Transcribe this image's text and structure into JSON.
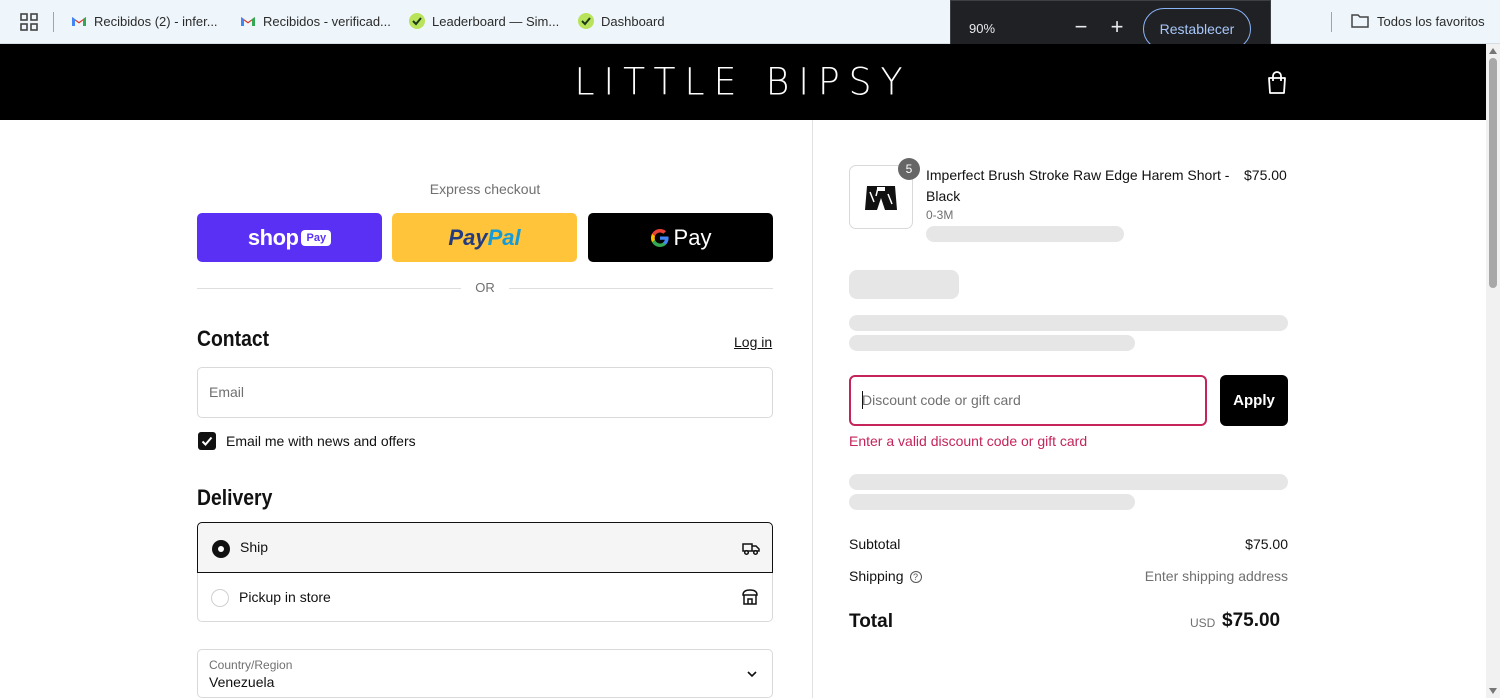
{
  "browser": {
    "bookmarks": [
      {
        "label": "Recibidos (2) - infer...",
        "icon": "gmail-icon"
      },
      {
        "label": "Recibidos - verificad...",
        "icon": "gmail-icon"
      },
      {
        "label": "Leaderboard — Sim...",
        "icon": "site-icon"
      },
      {
        "label": "Dashboard",
        "icon": "site-icon"
      }
    ],
    "all_bookmarks": "Todos los favoritos",
    "zoom": {
      "value": "90%",
      "minus": "−",
      "plus": "+",
      "reset": "Restablecer"
    }
  },
  "shop": {
    "brand": "LITTLE BIPSY"
  },
  "checkout": {
    "express_label": "Express checkout",
    "express": {
      "shop": "shop",
      "shop_pay": "Pay",
      "paypal_a": "Pay",
      "paypal_b": "Pal",
      "gpay": "Pay"
    },
    "or": "OR",
    "contact": {
      "heading": "Contact",
      "login": "Log in",
      "email_placeholder": "Email",
      "newsletter": "Email me with news and offers"
    },
    "delivery": {
      "heading": "Delivery",
      "ship": "Ship",
      "pickup": "Pickup in store"
    },
    "country": {
      "label": "Country/Region",
      "value": "Venezuela"
    }
  },
  "summary": {
    "product": {
      "title": "Imperfect Brush Stroke Raw Edge Harem Short - Black",
      "variant": "0-3M",
      "price": "$75.00",
      "qty": "5"
    },
    "discount": {
      "placeholder": "Discount code or gift card",
      "apply": "Apply",
      "error": "Enter a valid discount code or gift card"
    },
    "subtotal_label": "Subtotal",
    "subtotal": "$75.00",
    "shipping_label": "Shipping",
    "shipping_note": "Enter shipping address",
    "total_label": "Total",
    "currency": "USD",
    "total": "$75.00"
  },
  "colors": {
    "shop_pay": "#5a31f4",
    "paypal": "#ffc439",
    "error": "#c4245a"
  }
}
